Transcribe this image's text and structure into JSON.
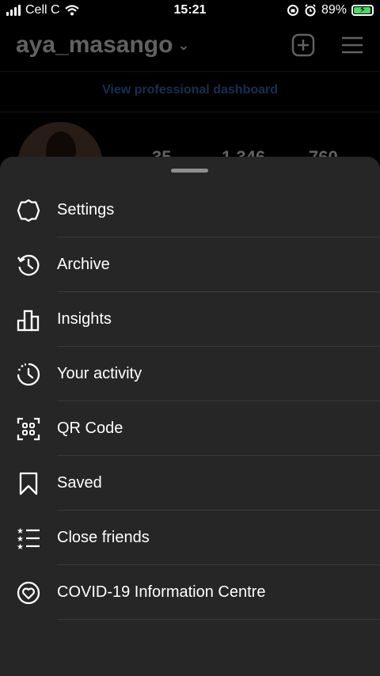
{
  "status_bar": {
    "carrier": "Cell C",
    "time": "15:21",
    "battery": "89%"
  },
  "profile": {
    "username": "aya_masango",
    "professional_dashboard": "View professional dashboard",
    "stats": [
      "35",
      "1 346",
      "760"
    ]
  },
  "menu": {
    "items": [
      {
        "label": "Settings",
        "icon": "settings-icon"
      },
      {
        "label": "Archive",
        "icon": "archive-icon"
      },
      {
        "label": "Insights",
        "icon": "insights-icon"
      },
      {
        "label": "Your activity",
        "icon": "activity-icon"
      },
      {
        "label": "QR Code",
        "icon": "qr-code-icon"
      },
      {
        "label": "Saved",
        "icon": "bookmark-icon"
      },
      {
        "label": "Close friends",
        "icon": "close-friends-icon"
      },
      {
        "label": "COVID-19 Information Centre",
        "icon": "covid-info-icon"
      }
    ]
  }
}
